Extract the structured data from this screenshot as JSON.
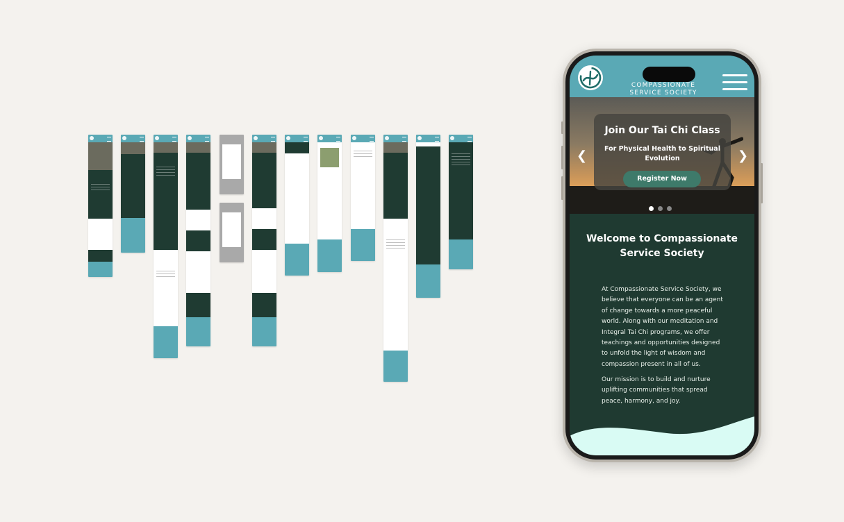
{
  "phone": {
    "org_name_line1": "COMPASSIONATE",
    "org_name_line2": "SERVICE SOCIETY",
    "hero": {
      "title": "Join Our Tai Chi Class",
      "subtitle": "For Physical Health to Spiritual Evolution",
      "button": "Register Now",
      "prev_icon": "chevron-left-icon",
      "next_icon": "chevron-right-icon",
      "slide_count": 3,
      "active_slide": 1
    },
    "welcome": {
      "heading": "Welcome to Compassionate Service Society",
      "paragraph1": "At Compassionate Service Society, we believe that everyone can be an agent of change towards a more peaceful world. Along with our meditation and Integral Tai Chi programs, we offer teachings and opportunities designed to unfold the light of wisdom and compassion present in all of us.",
      "paragraph2": "Our mission is to build and nurture uplifting communities that spread peace, harmony, and joy."
    }
  },
  "colors": {
    "teal": "#5aa9b5",
    "dark_green": "#1f3a31",
    "mint": "#d9fbf4",
    "button_green": "#3e7a6a",
    "background": "#f4f2ee"
  }
}
